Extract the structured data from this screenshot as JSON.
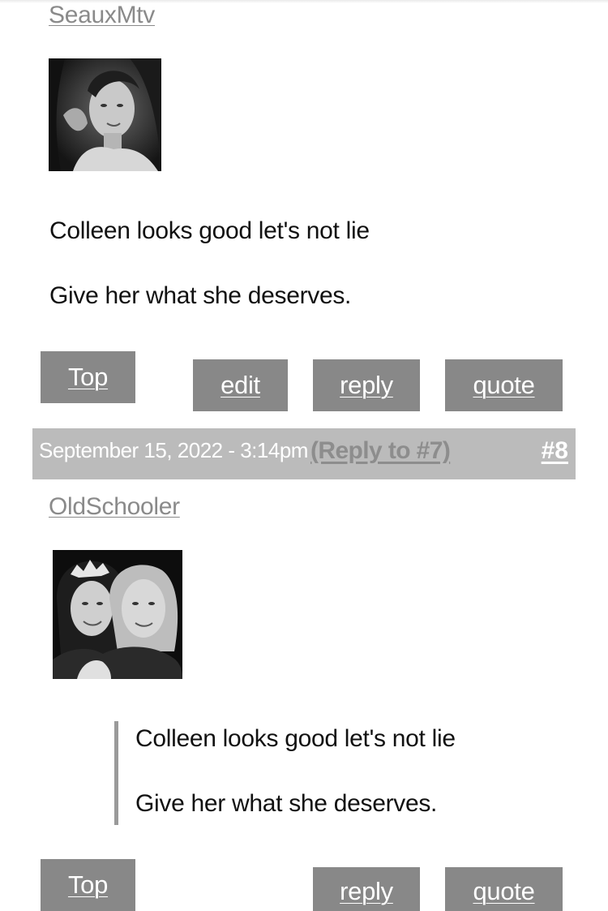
{
  "post7": {
    "author": "SeauxMtv",
    "lines": [
      "Colleen looks good let's not lie",
      "Give her what she deserves."
    ],
    "buttons": {
      "top": "Top",
      "edit": "edit",
      "reply": "reply",
      "quote": "quote"
    }
  },
  "post8": {
    "header": {
      "date": "September 15, 2022 - 3:14pm",
      "reply_to": "(Reply to #7)",
      "number": "#8"
    },
    "author": "OldSchooler",
    "quote_lines": [
      "Colleen looks good let's not lie",
      "Give her what she deserves."
    ],
    "buttons": {
      "top": "Top",
      "reply": "reply",
      "quote": "quote"
    }
  }
}
